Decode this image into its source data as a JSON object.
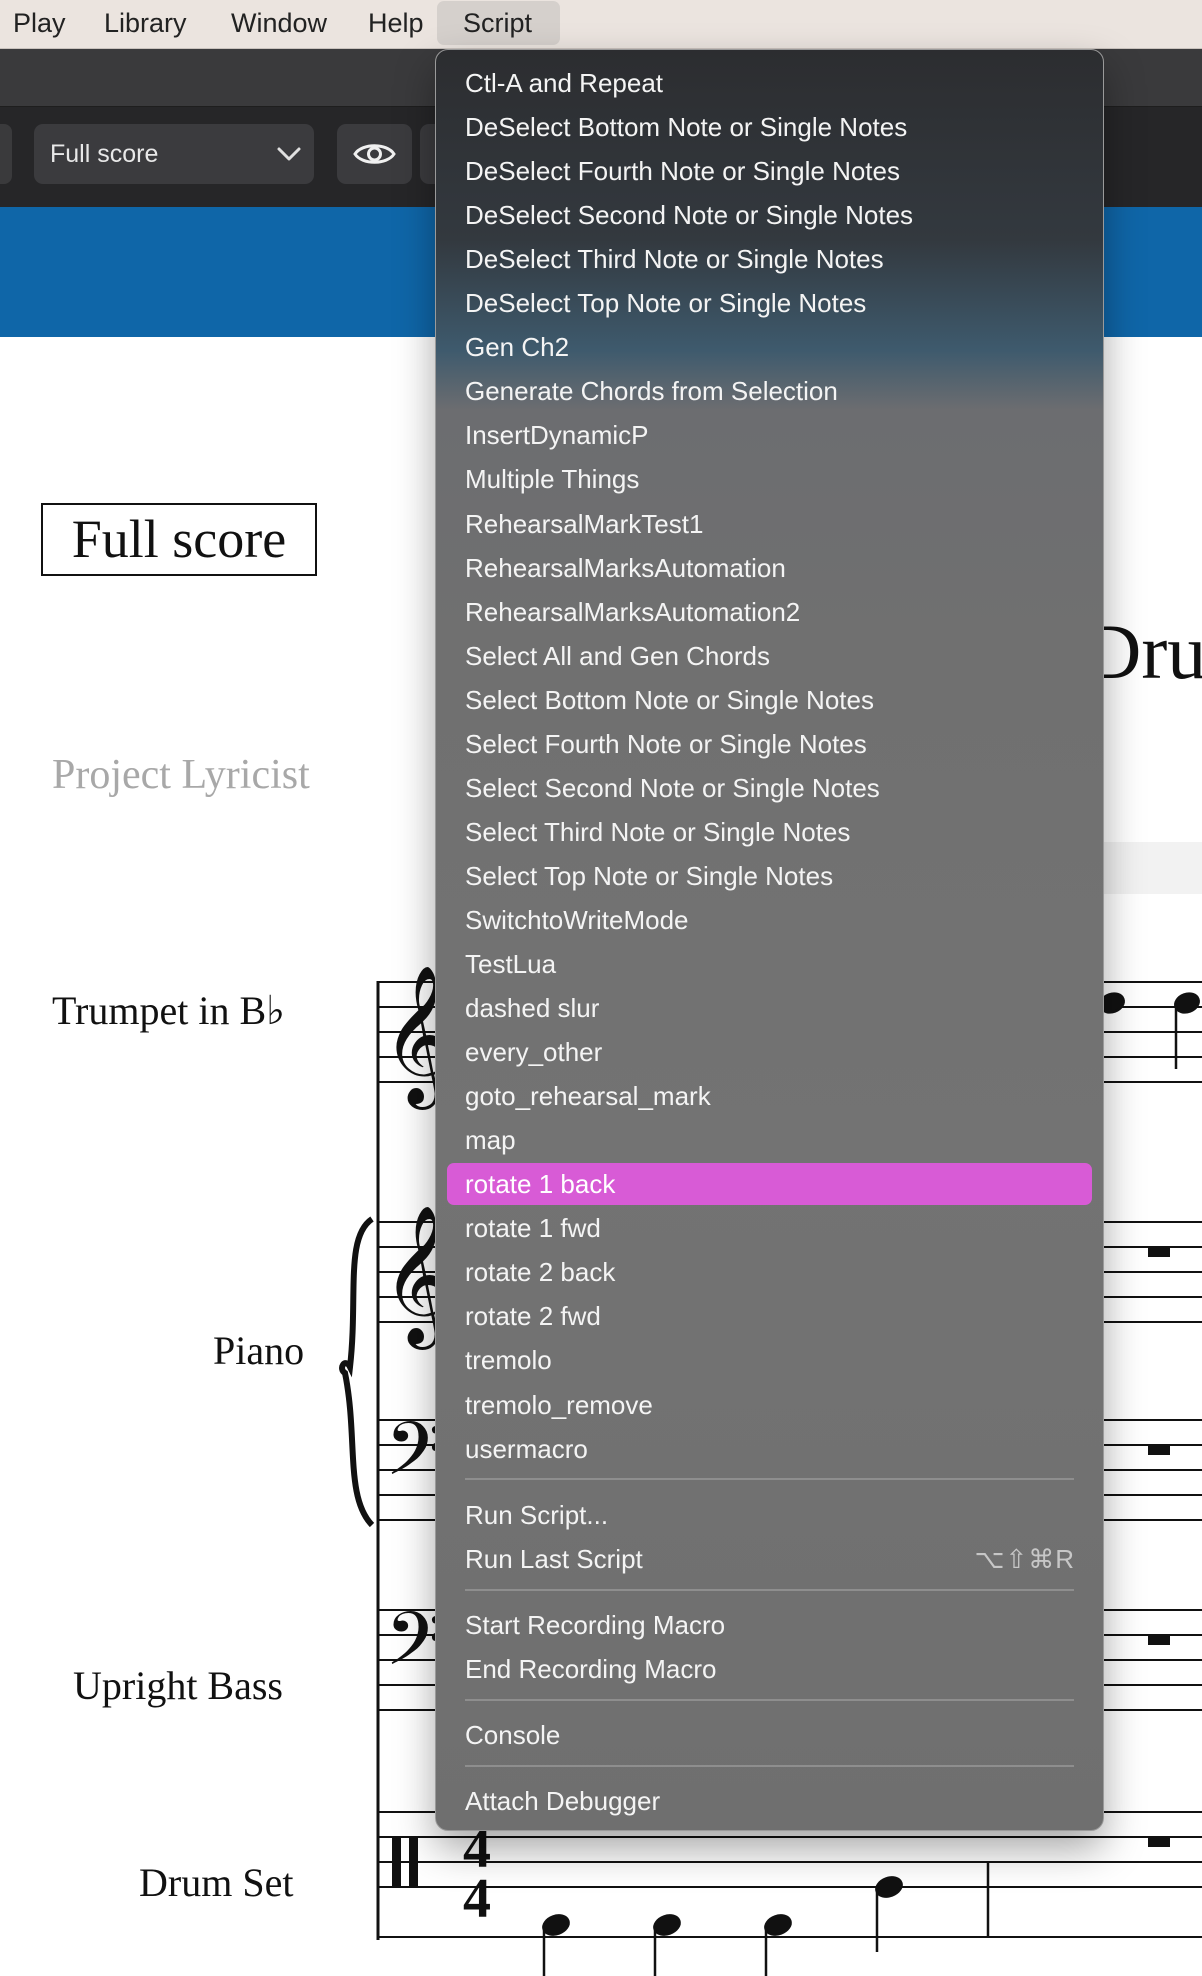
{
  "menubar": {
    "items": [
      {
        "label": "Play"
      },
      {
        "label": "Library"
      },
      {
        "label": "Window"
      },
      {
        "label": "Help"
      },
      {
        "label": "Script",
        "active": true
      }
    ]
  },
  "toolbar": {
    "layout_select": {
      "value": "Full score"
    },
    "eye_icon": "eye-icon"
  },
  "score": {
    "title_box": "Full score",
    "lyricist": "Project Lyricist",
    "page_title_fragment": "Dru",
    "instruments": [
      "Trumpet in B♭",
      "Piano",
      "Upright Bass",
      "Drum Set"
    ],
    "time_signature": {
      "numerator": "4",
      "denominator": "4"
    }
  },
  "script_menu": {
    "items": [
      "Ctl-A and Repeat",
      "DeSelect Bottom Note or Single Notes",
      "DeSelect Fourth Note or Single Notes",
      "DeSelect Second Note or Single Notes",
      "DeSelect Third Note or Single Notes",
      "DeSelect Top Note or Single Notes",
      "Gen Ch2",
      "Generate Chords from Selection",
      "InsertDynamicP",
      "Multiple Things",
      "RehearsalMarkTest1",
      "RehearsalMarksAutomation",
      "RehearsalMarksAutomation2",
      "Select All and Gen Chords",
      "Select Bottom Note or Single Notes",
      "Select Fourth Note or Single Notes",
      "Select Second Note or Single Notes",
      "Select Third Note or Single Notes",
      "Select Top Note or Single Notes",
      "SwitchtoWriteMode",
      "TestLua",
      "dashed slur",
      "every_other",
      "goto_rehearsal_mark",
      "map",
      "rotate 1 back",
      "rotate 1 fwd",
      "rotate 2 back",
      "rotate 2 fwd",
      "tremolo",
      "tremolo_remove",
      "usermacro"
    ],
    "highlighted": "rotate 1 back",
    "highlight_color": "#d85bd6",
    "run_script": "Run Script...",
    "run_last_script": "Run Last Script",
    "run_last_shortcut": "⌥⇧⌘R",
    "start_recording": "Start Recording Macro",
    "end_recording": "End Recording Macro",
    "console": "Console",
    "attach_debugger": "Attach Debugger"
  }
}
